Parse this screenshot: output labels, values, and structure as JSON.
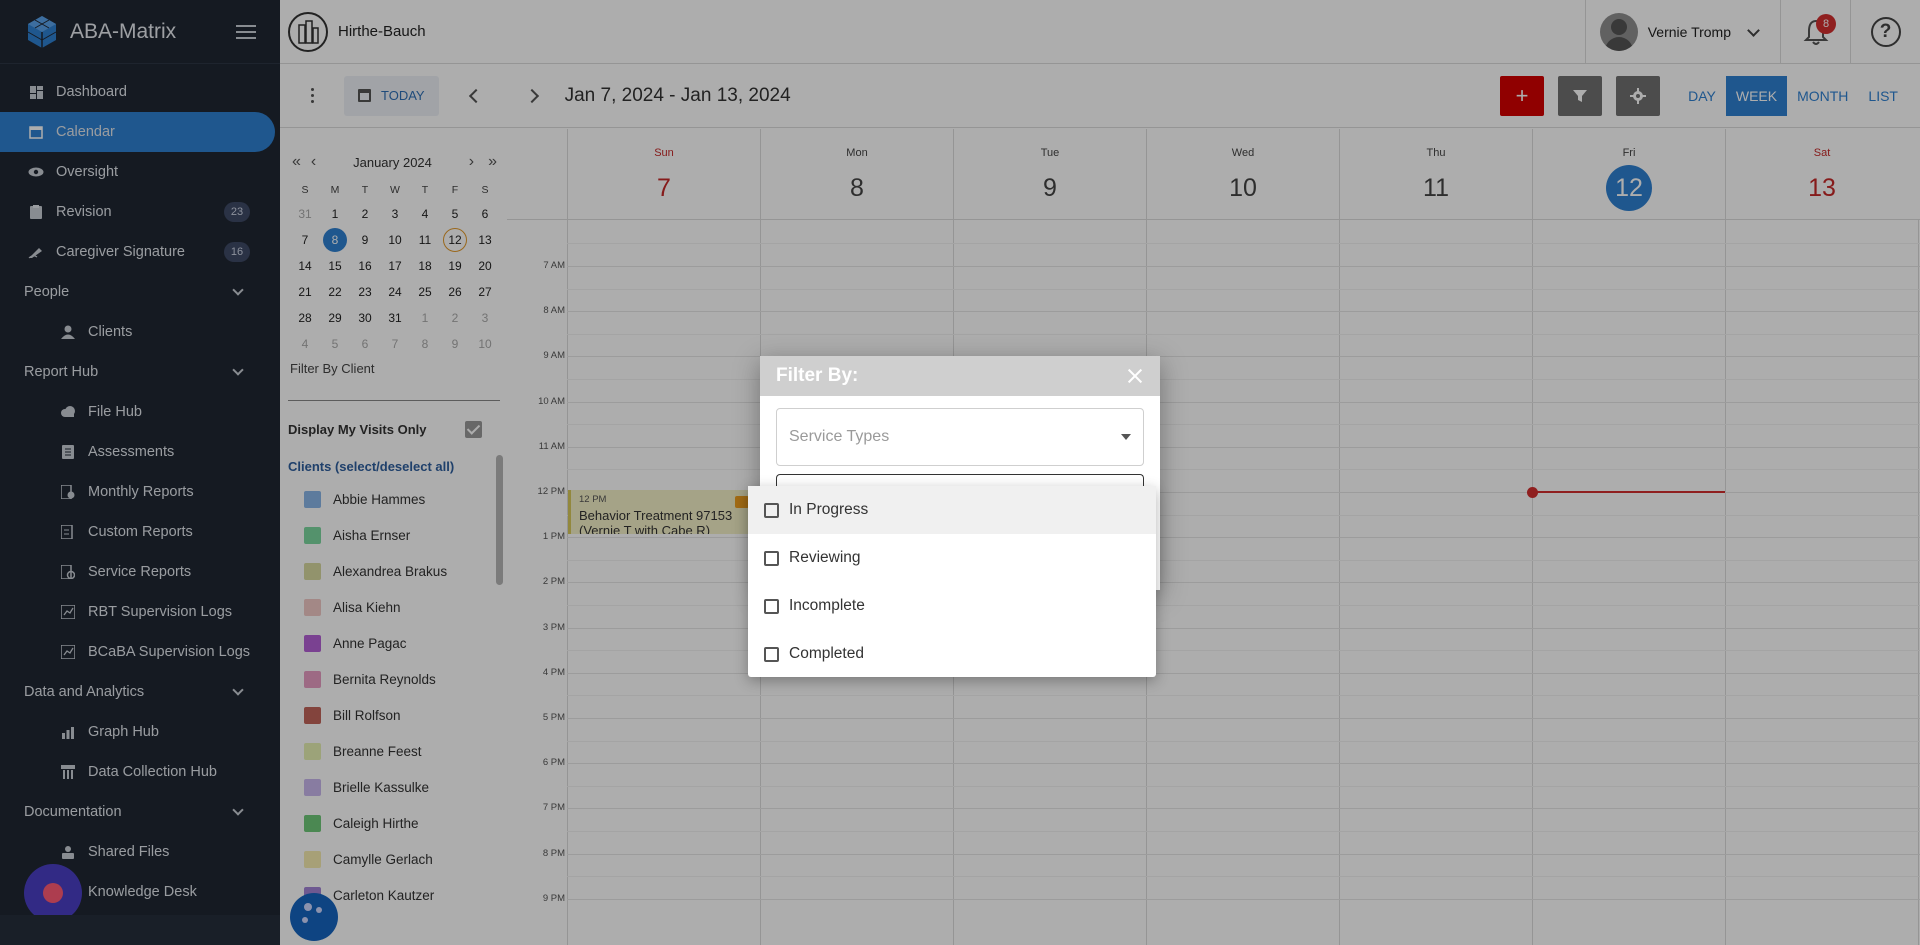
{
  "app": {
    "name": "ABA-Matrix"
  },
  "sidebar": {
    "items": [
      {
        "label": "Dashboard",
        "icon": "dashboard-icon"
      },
      {
        "label": "Calendar",
        "icon": "calendar-icon",
        "active": true
      },
      {
        "label": "Oversight",
        "icon": "eye-icon"
      },
      {
        "label": "Revision",
        "icon": "clipboard-icon",
        "badge": "23"
      },
      {
        "label": "Caregiver Signature",
        "icon": "signature-icon",
        "badge": "16"
      }
    ],
    "sections": [
      {
        "label": "People",
        "items": [
          {
            "label": "Clients",
            "icon": "person-icon"
          }
        ]
      },
      {
        "label": "Report Hub",
        "items": [
          {
            "label": "File Hub",
            "icon": "cloud-icon"
          },
          {
            "label": "Assessments",
            "icon": "assessment-icon"
          },
          {
            "label": "Monthly Reports",
            "icon": "report-icon"
          },
          {
            "label": "Custom Reports",
            "icon": "report-icon"
          },
          {
            "label": "Service Reports",
            "icon": "report-icon"
          },
          {
            "label": "RBT Supervision Logs",
            "icon": "log-icon"
          },
          {
            "label": "BCaBA Supervision Logs",
            "icon": "log-icon"
          }
        ]
      },
      {
        "label": "Data and Analytics",
        "items": [
          {
            "label": "Graph Hub",
            "icon": "graph-icon"
          },
          {
            "label": "Data Collection Hub",
            "icon": "data-icon"
          }
        ]
      },
      {
        "label": "Documentation",
        "items": [
          {
            "label": "Shared Files",
            "icon": "shared-files-icon"
          },
          {
            "label": "Knowledge Desk",
            "icon": "book-icon"
          }
        ]
      }
    ]
  },
  "topbar": {
    "org_name": "Hirthe-Bauch",
    "user_name": "Vernie Tromp",
    "notifications": "8",
    "help": "?"
  },
  "toolbar": {
    "today_label": "TODAY",
    "range": "Jan 7, 2024 - Jan 13, 2024",
    "add": "+",
    "views": [
      "DAY",
      "WEEK",
      "MONTH",
      "LIST"
    ],
    "active_view": "WEEK"
  },
  "mini_calendar": {
    "title": "January 2024",
    "dow": [
      "S",
      "M",
      "T",
      "W",
      "T",
      "F",
      "S"
    ],
    "weeks": [
      [
        "31",
        "1",
        "2",
        "3",
        "4",
        "5",
        "6"
      ],
      [
        "7",
        "8",
        "9",
        "10",
        "11",
        "12",
        "13"
      ],
      [
        "14",
        "15",
        "16",
        "17",
        "18",
        "19",
        "20"
      ],
      [
        "21",
        "22",
        "23",
        "24",
        "25",
        "26",
        "27"
      ],
      [
        "28",
        "29",
        "30",
        "31",
        "1",
        "2",
        "3"
      ],
      [
        "4",
        "5",
        "6",
        "7",
        "8",
        "9",
        "10"
      ]
    ],
    "selected": "8",
    "today": "12"
  },
  "client_filter": {
    "label": "Filter By Client",
    "my_visits_label": "Display My Visits Only",
    "clients_header": "Clients (select/deselect all)",
    "clients": [
      {
        "name": "Abbie Hammes",
        "color": "#8ab6e8"
      },
      {
        "name": "Aisha Ernser",
        "color": "#7dd8a0"
      },
      {
        "name": "Alexandrea Brakus",
        "color": "#d7d9a0"
      },
      {
        "name": "Alisa Kiehn",
        "color": "#f0c9c6"
      },
      {
        "name": "Anne Pagac",
        "color": "#b461d6"
      },
      {
        "name": "Bernita Reynolds",
        "color": "#e79dc3"
      },
      {
        "name": "Bill Rolfson",
        "color": "#c1655a"
      },
      {
        "name": "Breanne Feest",
        "color": "#e6f0b3"
      },
      {
        "name": "Brielle Kassulke",
        "color": "#c9b7ee"
      },
      {
        "name": "Caleigh Hirthe",
        "color": "#6fc97a"
      },
      {
        "name": "Camylle Gerlach",
        "color": "#f6ecb0"
      },
      {
        "name": "Carleton Kautzer",
        "color": "#a283d6"
      }
    ]
  },
  "week": {
    "days": [
      {
        "name": "Sun",
        "num": "7",
        "weekend": true
      },
      {
        "name": "Mon",
        "num": "8"
      },
      {
        "name": "Tue",
        "num": "9"
      },
      {
        "name": "Wed",
        "num": "10"
      },
      {
        "name": "Thu",
        "num": "11"
      },
      {
        "name": "Fri",
        "num": "12",
        "today": true
      },
      {
        "name": "Sat",
        "num": "13",
        "weekend": true
      }
    ],
    "hours": [
      "7 AM",
      "8 AM",
      "9 AM",
      "10 AM",
      "11 AM",
      "12 PM",
      "1 PM",
      "2 PM",
      "3 PM",
      "4 PM",
      "5 PM",
      "6 PM",
      "7 PM",
      "8 PM",
      "9 PM"
    ],
    "event": {
      "time": "12 PM",
      "title": "Behavior Treatment 97153 (Vernie T with Cabe R)"
    }
  },
  "modal": {
    "title": "Filter By:",
    "service_types_placeholder": "Service Types",
    "status_options": [
      "In Progress",
      "Reviewing",
      "Incomplete",
      "Completed"
    ]
  }
}
